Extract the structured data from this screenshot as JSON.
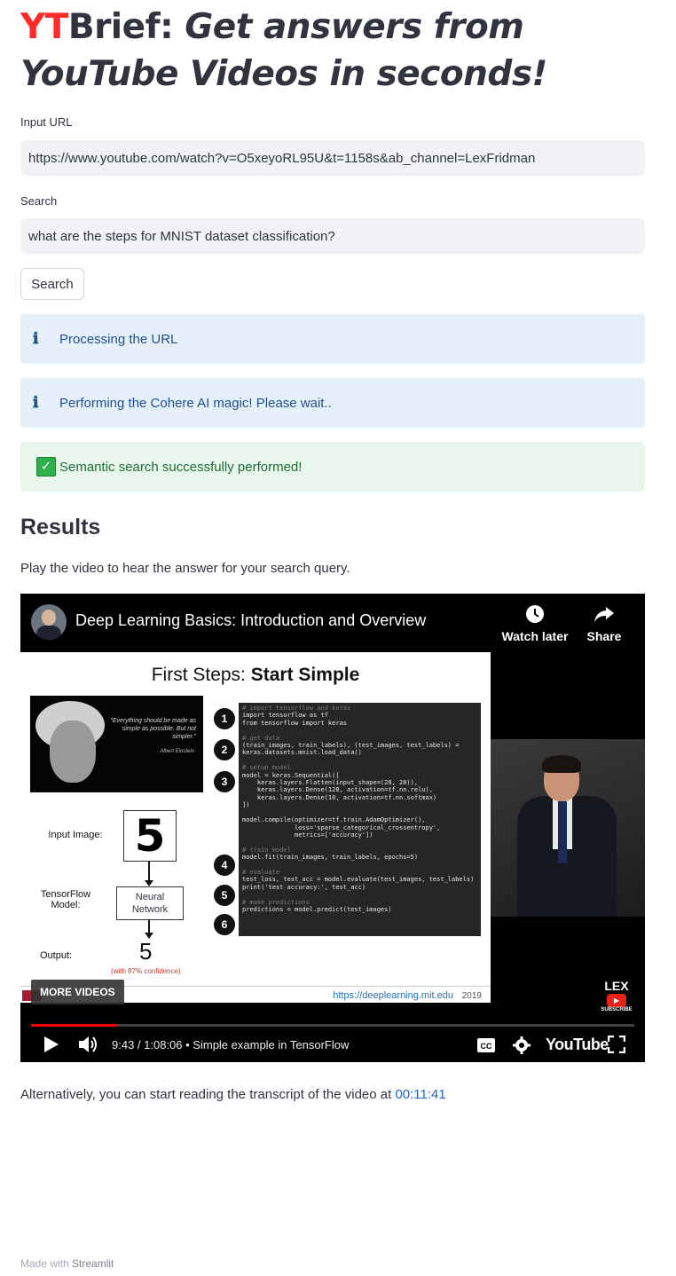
{
  "app": {
    "title_brand_red": "YT",
    "title_brand_rest": "Brief:",
    "title_tagline": "Get answers from YouTube Videos in seconds!"
  },
  "form": {
    "url_label": "Input URL",
    "url_value": "https://www.youtube.com/watch?v=O5xeyoRL95U&t=1158s&ab_channel=LexFridman",
    "search_label": "Search",
    "search_value": "what are the steps for MNIST dataset classification?",
    "search_button": "Search"
  },
  "alerts": [
    {
      "type": "info",
      "icon": "info-icon",
      "text": "Processing the URL"
    },
    {
      "type": "info",
      "icon": "info-icon",
      "text": "Performing the Cohere AI magic! Please wait.."
    },
    {
      "type": "success",
      "icon": "check-mark-icon",
      "text": "Semantic search successfully performed!"
    }
  ],
  "results": {
    "heading": "Results",
    "intro": "Play the video to hear the answer for your search query.",
    "alt_text": "Alternatively, you can start reading the transcript of the video at",
    "timestamp_link": "00:11:41"
  },
  "video": {
    "title": "Deep Learning Basics: Introduction and Overview",
    "watch_later": "Watch later",
    "share": "Share",
    "more_videos": "MORE VIDEOS",
    "time_display": "9:43 / 1:08:06",
    "chapter": "• Simple example in TensorFlow",
    "progress_fraction": 0.143,
    "youtube_logo": "YouTube",
    "channel_badge": "LEX",
    "subscribe": "SUBSCRIBE",
    "slide": {
      "title_plain": "First Steps:",
      "title_bold": "Start Simple",
      "quote": "\"Everything should be made as simple as possible. But not simpler.\"",
      "quote_author": "Albert Einstein",
      "input_label": "Input Image:",
      "model_label": "TensorFlow Model:",
      "network_label": "Neural Network",
      "output_label": "Output:",
      "input_digit": "5",
      "output_digit": "5",
      "confidence": "(with 87% confidence)",
      "url": "https://deeplearning.mit.edu",
      "year": "2019",
      "steps": [
        "1",
        "2",
        "3",
        "4",
        "5",
        "6"
      ]
    }
  },
  "footer": {
    "made_with": "Made with",
    "brand": "Streamlit"
  },
  "colors": {
    "brand_red": "#ff2b2b",
    "info_bg": "#e6f0fb",
    "success_bg": "#e8f6ec",
    "link": "#1c66c8"
  }
}
